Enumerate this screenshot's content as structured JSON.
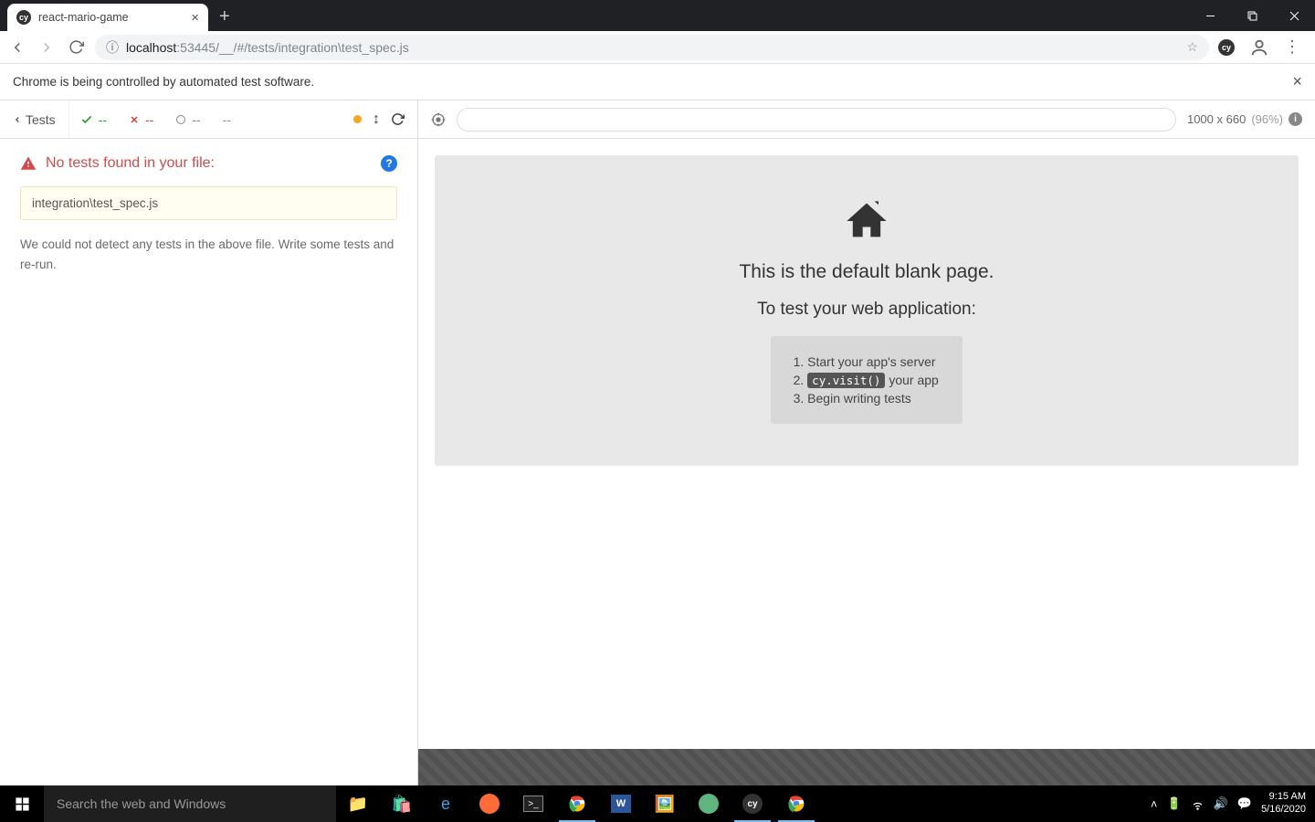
{
  "browser": {
    "tab_title": "react-mario-game",
    "url_host": "localhost",
    "url_port": ":53445",
    "url_path": "/__/#/tests/integration\\test_spec.js"
  },
  "infobar": {
    "message": "Chrome is being controlled by automated test software."
  },
  "runner": {
    "tests_label": "Tests",
    "pass_count": "--",
    "fail_count": "--",
    "pending_count": "--",
    "duration": "--",
    "error_title": "No tests found in your file:",
    "spec_file": "integration\\test_spec.js",
    "error_desc": "We could not detect any tests in the above file. Write some tests and re-run."
  },
  "preview": {
    "viewport": "1000 x 660",
    "scale": "(96%)",
    "heading1": "This is the default blank page.",
    "heading2": "To test your web application:",
    "step1": "Start your app's server",
    "step2_code": "cy.visit()",
    "step2_suffix": " your app",
    "step3": "Begin writing tests"
  },
  "taskbar": {
    "search_placeholder": "Search the web and Windows",
    "time": "9:15 AM",
    "date": "5/16/2020"
  }
}
